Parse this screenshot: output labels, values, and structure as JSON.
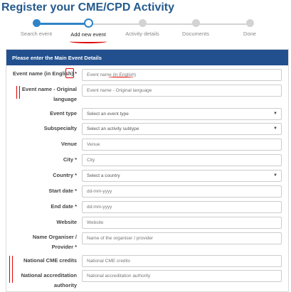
{
  "page": {
    "title": "Register your CME/CPD Activity"
  },
  "steps": [
    {
      "label": "Search event"
    },
    {
      "label": "Add new event"
    },
    {
      "label": "Activity details"
    },
    {
      "label": "Documents"
    },
    {
      "label": "Done"
    }
  ],
  "panel": {
    "heading": "Please enter the Main Event Details"
  },
  "form": {
    "event_name": {
      "label": "Event name (in English)",
      "required": "*",
      "placeholder": "Event name (in English)"
    },
    "event_name_original": {
      "label": "Event name - Original language",
      "placeholder": "Event name - Original language"
    },
    "event_type": {
      "label": "Event type",
      "value": "Select an event type"
    },
    "subspecialty": {
      "label": "Subspecialty",
      "value": "Select an activity subtype"
    },
    "venue": {
      "label": "Venue",
      "placeholder": "Venue"
    },
    "city": {
      "label": "City *",
      "placeholder": "City"
    },
    "country": {
      "label": "Country *",
      "value": "Select a country"
    },
    "start_date": {
      "label": "Start date *",
      "placeholder": "dd-mm-yyyy"
    },
    "end_date": {
      "label": "End date *",
      "placeholder": "dd-mm-yyyy"
    },
    "website": {
      "label": "Website",
      "placeholder": "Website"
    },
    "organiser": {
      "label": "Name Organiser / Provider *",
      "placeholder": "Name of the organiser / provider"
    },
    "national_cme": {
      "label": "National CME credits",
      "placeholder": "National CME credits"
    },
    "accreditation": {
      "label": "National accreditation authority",
      "placeholder": "National accreditation authority"
    }
  },
  "icons": {
    "dropdown": "chevron-down-icon",
    "dropdown_glyph": "▼"
  }
}
